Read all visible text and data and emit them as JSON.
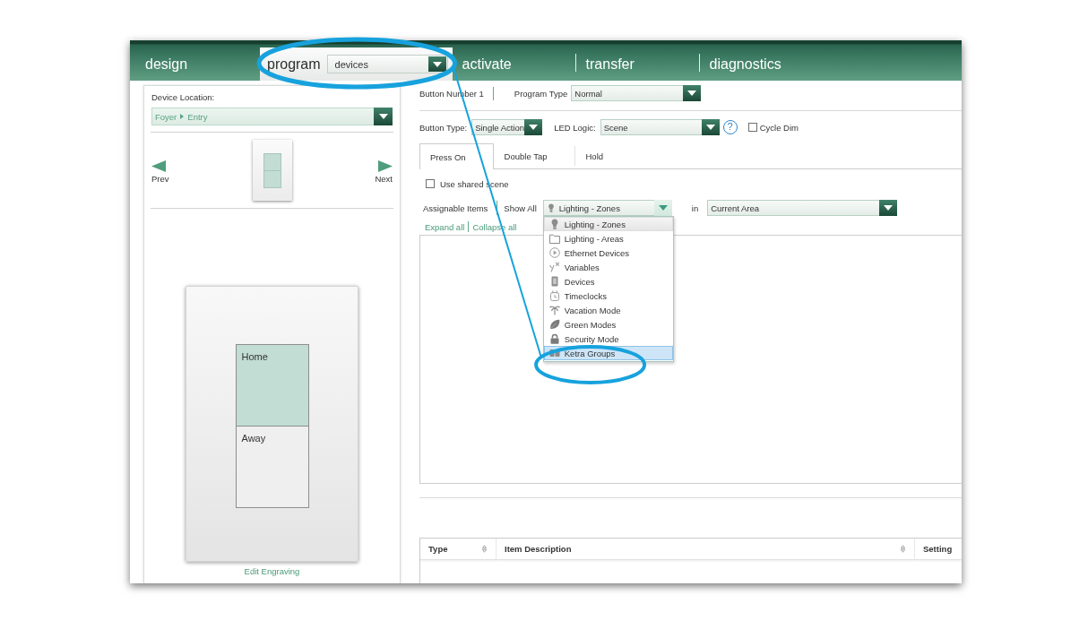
{
  "nav": {
    "tabs": [
      {
        "label": "design",
        "selected": false,
        "circled": false
      },
      {
        "label": "program",
        "selected": true,
        "circled": true,
        "dropdown": "devices"
      },
      {
        "label": "activate",
        "selected": false,
        "circled": false
      },
      {
        "label": "transfer",
        "selected": false,
        "circled": false
      },
      {
        "label": "diagnostics",
        "selected": false,
        "circled": false
      }
    ]
  },
  "device_panel": {
    "location_label": "Device Location:",
    "location": [
      "Foyer",
      "Entry"
    ],
    "prev": "Prev",
    "next": "Next",
    "buttons": [
      {
        "label": "Home",
        "selected": true
      },
      {
        "label": "Away",
        "selected": false
      }
    ],
    "edit_link": "Edit Engraving"
  },
  "button_settings": {
    "button_number": "Button Number 1",
    "program_type_label": "Program Type",
    "program_type": "Normal",
    "button_type_label": "Button Type:",
    "button_type": "Single Action",
    "led_logic_label": "LED Logic:",
    "led_logic": "Scene",
    "help": "?",
    "cycle_dim": {
      "label": "Cycle Dim",
      "checked": false
    }
  },
  "action_tabs": [
    {
      "label": "Press On",
      "selected": true
    },
    {
      "label": "Double Tap",
      "selected": false
    },
    {
      "label": "Hold",
      "selected": false
    }
  ],
  "use_shared_scene": {
    "label": "Use shared scene",
    "checked": false
  },
  "assignable_items": {
    "label": "Assignable Items",
    "show_all": "Show All",
    "filter": {
      "value": "Lighting - Zones",
      "kind": "zone",
      "open": true,
      "options": [
        {
          "label": "Lighting - Zones",
          "kind": "zone",
          "selected": true,
          "hovered": false,
          "circled": false
        },
        {
          "label": "Lighting - Areas",
          "kind": "area",
          "selected": false,
          "hovered": false,
          "circled": false
        },
        {
          "label": "Ethernet Devices",
          "kind": "ethernet",
          "selected": false,
          "hovered": false,
          "circled": false
        },
        {
          "label": "Variables",
          "kind": "variable",
          "selected": false,
          "hovered": false,
          "circled": false
        },
        {
          "label": "Devices",
          "kind": "device",
          "selected": false,
          "hovered": false,
          "circled": false
        },
        {
          "label": "Timeclocks",
          "kind": "timeclock",
          "selected": false,
          "hovered": false,
          "circled": false
        },
        {
          "label": "Vacation Mode",
          "kind": "vacation",
          "selected": false,
          "hovered": false,
          "circled": false
        },
        {
          "label": "Green Modes",
          "kind": "green",
          "selected": false,
          "hovered": false,
          "circled": false
        },
        {
          "label": "Security Mode",
          "kind": "security",
          "selected": false,
          "hovered": false,
          "circled": false
        },
        {
          "label": "Ketra Groups",
          "kind": "ketra",
          "selected": false,
          "hovered": true,
          "circled": true
        }
      ]
    },
    "in_label": "in",
    "area": "Current Area",
    "expand_all": "Expand all",
    "collapse_all": "Collapse all"
  },
  "table": {
    "columns": [
      {
        "label": "Type",
        "sortable": true
      },
      {
        "label": "Item Description",
        "sortable": true
      },
      {
        "label": "Setting",
        "sortable": false
      }
    ]
  }
}
